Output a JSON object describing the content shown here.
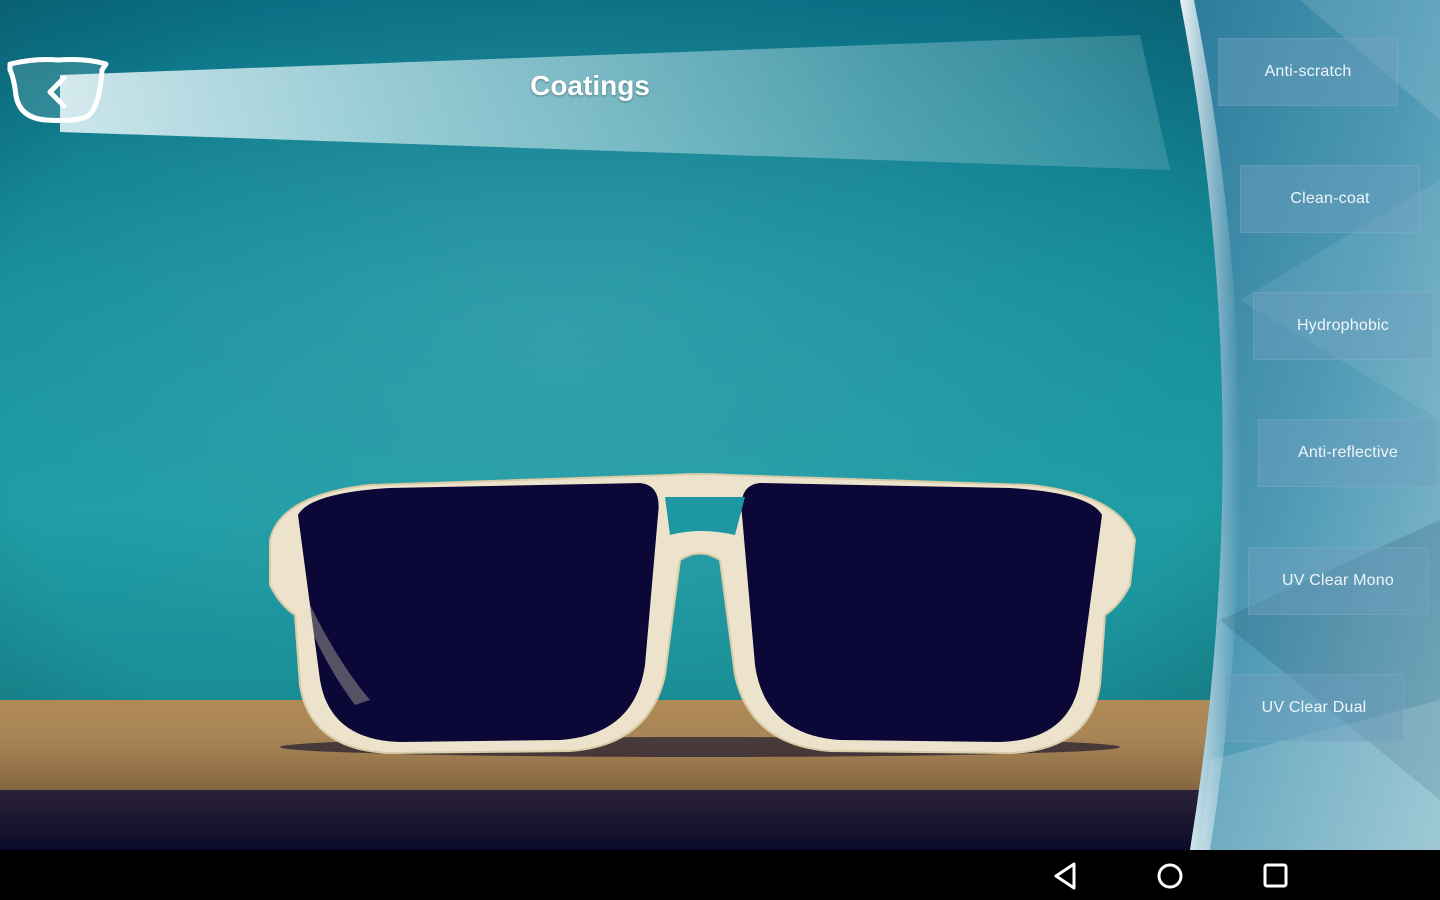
{
  "header": {
    "title": "Coatings"
  },
  "coatings": [
    {
      "label": "Anti-scratch"
    },
    {
      "label": "Clean-coat"
    },
    {
      "label": "Hydrophobic"
    },
    {
      "label": "Anti-reflective"
    },
    {
      "label": "UV Clear Mono"
    },
    {
      "label": "UV Clear Dual"
    }
  ],
  "icons": {
    "back": "back-glasses-icon",
    "nav_back": "nav-back-icon",
    "nav_home": "nav-home-icon",
    "nav_recents": "nav-recents-icon"
  },
  "colors": {
    "background_teal": "#1f9da5",
    "button_fill": "#6ea0be",
    "title_text": "#ffffff"
  }
}
